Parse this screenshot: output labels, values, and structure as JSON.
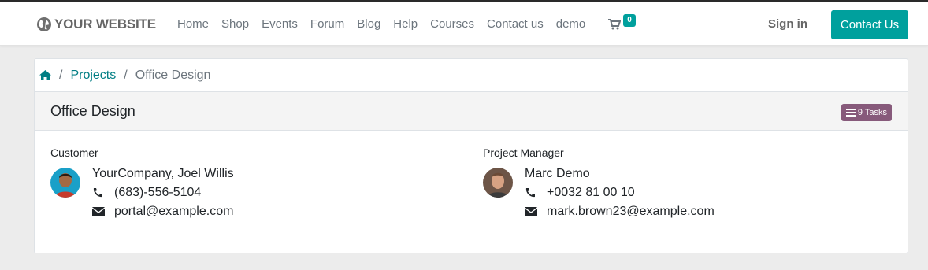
{
  "header": {
    "brand": "YOUR WEBSITE",
    "nav": [
      "Home",
      "Shop",
      "Events",
      "Forum",
      "Blog",
      "Help",
      "Courses",
      "Contact us",
      "demo"
    ],
    "cart_count": "0",
    "sign_in": "Sign in",
    "contact_button": "Contact Us"
  },
  "breadcrumb": {
    "home_icon": "home-icon",
    "items": [
      "Projects",
      "Office Design"
    ]
  },
  "project": {
    "title": "Office Design",
    "tasks_badge": "9 Tasks"
  },
  "customer": {
    "label": "Customer",
    "name": "YourCompany, Joel Willis",
    "phone": "(683)-556-5104",
    "email": "portal@example.com"
  },
  "manager": {
    "label": "Project Manager",
    "name": "Marc Demo",
    "phone": "+0032 81 00 10",
    "email": "mark.brown23@example.com"
  },
  "colors": {
    "primary": "#00a09d",
    "link": "#017e84",
    "badge": "#875a7b"
  }
}
